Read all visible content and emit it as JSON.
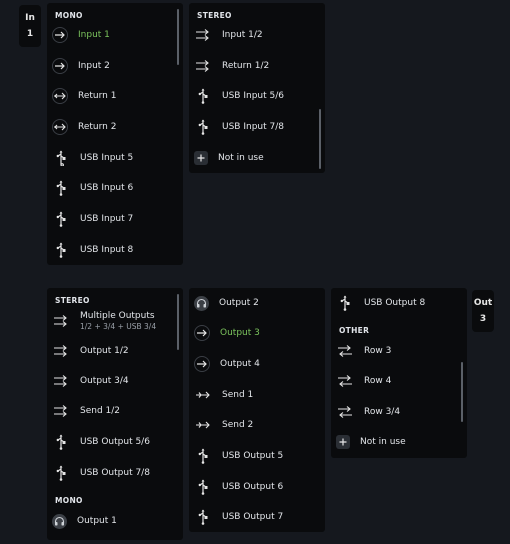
{
  "badges": {
    "input": {
      "label": "In",
      "number": "1"
    },
    "output": {
      "label": "Out",
      "number": "3"
    }
  },
  "colors": {
    "active": "#7bc35d",
    "panel": "#0a0b0d",
    "background": "#15181e"
  },
  "input_panel_mono": {
    "header": "MONO",
    "items": [
      {
        "label": "Input 1",
        "icon": "arrow-right-icon",
        "active": true
      },
      {
        "label": "Input 2",
        "icon": "arrow-right-icon"
      },
      {
        "label": "Return 1",
        "icon": "return-arrow-icon"
      },
      {
        "label": "Return 2",
        "icon": "return-arrow-icon"
      },
      {
        "label": "USB Input 5",
        "icon": "usb-icon"
      },
      {
        "label": "USB Input 6",
        "icon": "usb-icon"
      },
      {
        "label": "USB Input 7",
        "icon": "usb-icon"
      },
      {
        "label": "USB Input 8",
        "icon": "usb-icon"
      }
    ]
  },
  "input_panel_stereo": {
    "header": "STEREO",
    "items": [
      {
        "label": "Input 1/2",
        "icon": "stereo-arrows-icon"
      },
      {
        "label": "Return 1/2",
        "icon": "stereo-arrows-icon"
      },
      {
        "label": "USB Input 5/6",
        "icon": "usb-icon"
      },
      {
        "label": "USB Input 7/8",
        "icon": "usb-icon"
      },
      {
        "label": "Not in use",
        "icon": "plus-icon"
      }
    ]
  },
  "output_panel_left": {
    "stereo_header": "STEREO",
    "multiple": {
      "label": "Multiple Outputs",
      "sub": "1/2 + 3/4 + USB 3/4"
    },
    "items": [
      {
        "label": "Output 1/2",
        "icon": "stereo-arrows-icon"
      },
      {
        "label": "Output 3/4",
        "icon": "stereo-arrows-icon"
      },
      {
        "label": "Send 1/2",
        "icon": "stereo-arrows-icon"
      },
      {
        "label": "USB Output 5/6",
        "icon": "usb-icon"
      },
      {
        "label": "USB Output 7/8",
        "icon": "usb-icon"
      }
    ],
    "mono_header": "MONO",
    "mono_item": {
      "label": "Output 1",
      "icon": "headphones-icon"
    }
  },
  "output_panel_middle": {
    "items": [
      {
        "label": "Output 2",
        "icon": "headphones-icon"
      },
      {
        "label": "Output 3",
        "icon": "arrow-right-icon",
        "active": true
      },
      {
        "label": "Output 4",
        "icon": "arrow-right-icon"
      },
      {
        "label": "Send 1",
        "icon": "send-arrow-icon"
      },
      {
        "label": "Send 2",
        "icon": "send-arrow-icon"
      },
      {
        "label": "USB Output 5",
        "icon": "usb-icon"
      },
      {
        "label": "USB Output 6",
        "icon": "usb-icon"
      },
      {
        "label": "USB Output 7",
        "icon": "usb-icon"
      }
    ]
  },
  "output_panel_right": {
    "top_item": {
      "label": "USB Output 8",
      "icon": "usb-icon"
    },
    "other_header": "OTHER",
    "items": [
      {
        "label": "Row 3",
        "icon": "swap-arrows-icon"
      },
      {
        "label": "Row 4",
        "icon": "swap-arrows-icon"
      },
      {
        "label": "Row 3/4",
        "icon": "swap-arrows-icon"
      },
      {
        "label": "Not in use",
        "icon": "plus-icon"
      }
    ]
  }
}
